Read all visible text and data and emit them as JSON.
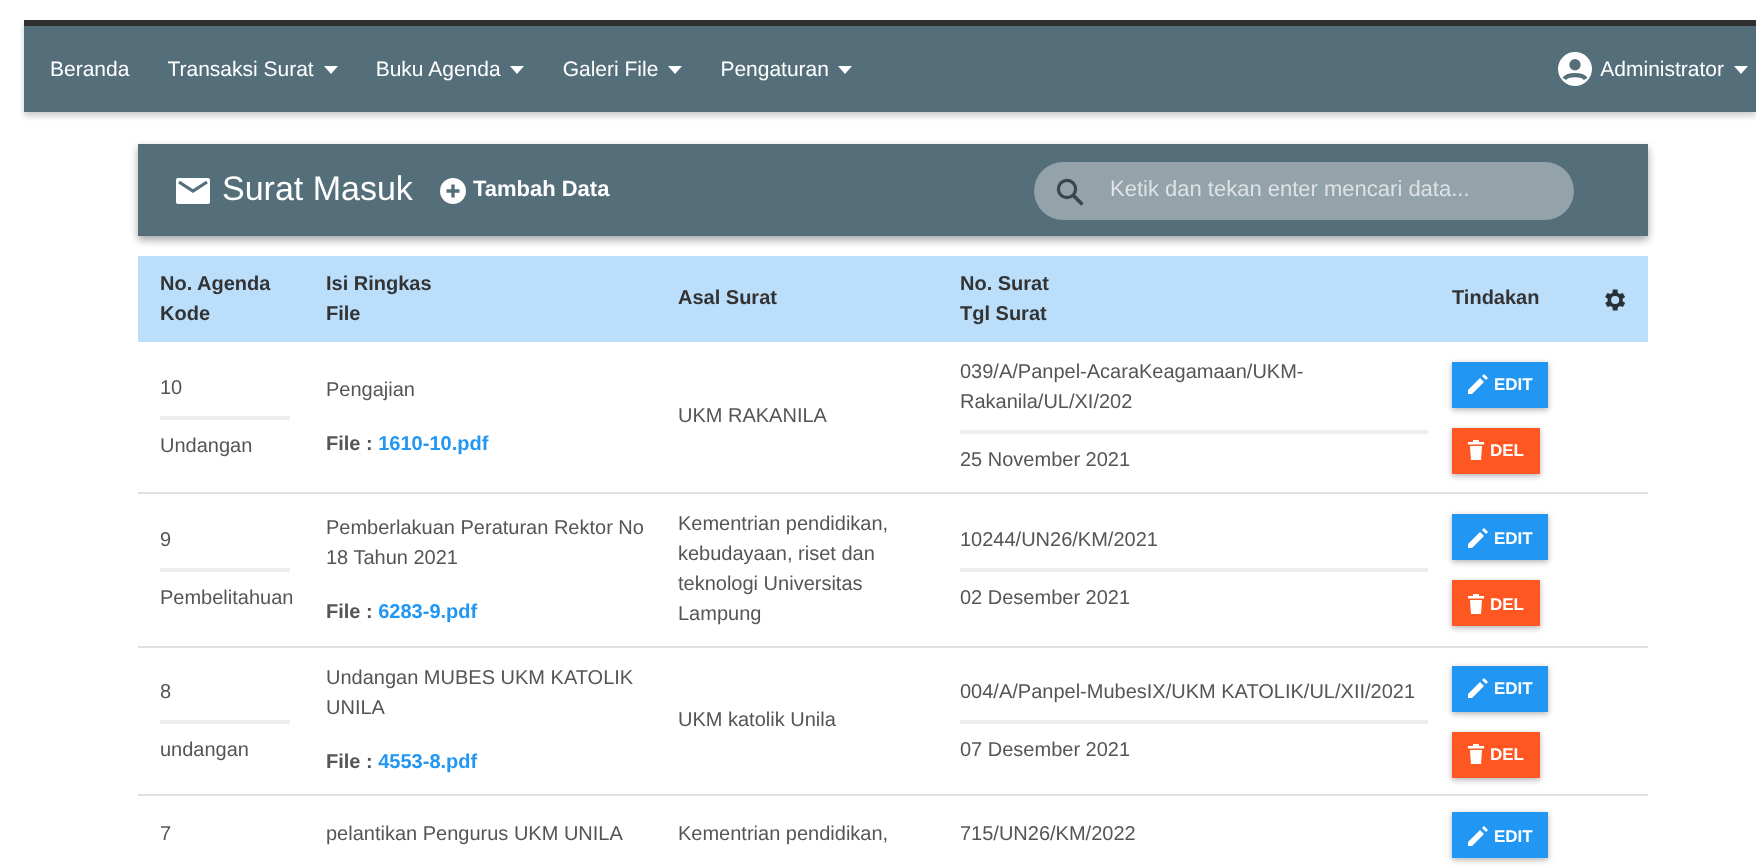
{
  "navbar": {
    "items": [
      {
        "label": "Beranda",
        "dropdown": false
      },
      {
        "label": "Transaksi Surat",
        "dropdown": true
      },
      {
        "label": "Buku Agenda",
        "dropdown": true
      },
      {
        "label": "Galeri File",
        "dropdown": true
      },
      {
        "label": "Pengaturan",
        "dropdown": true
      }
    ],
    "user": {
      "label": "Administrator",
      "dropdown": true
    }
  },
  "header": {
    "title": "Surat Masuk",
    "add_button": "Tambah Data",
    "search": {
      "placeholder": "Ketik dan tekan enter mencari data..."
    }
  },
  "table": {
    "columns": [
      {
        "kind": "text",
        "lines": [
          "No. Agenda",
          "Kode"
        ]
      },
      {
        "kind": "text",
        "lines": [
          "Isi Ringkas",
          "File"
        ]
      },
      {
        "kind": "text",
        "lines": [
          "Asal Surat"
        ]
      },
      {
        "kind": "text",
        "lines": [
          "No. Surat",
          "Tgl Surat"
        ]
      },
      {
        "kind": "text",
        "lines": [
          "Tindakan"
        ]
      },
      {
        "kind": "settings"
      }
    ],
    "rows": [
      {
        "agenda": "10",
        "kode": "Undangan",
        "isi": "Pengajian",
        "file_label": "File :",
        "file": "1610-10.pdf",
        "asal": "UKM RAKANILA",
        "no_surat": "039/A/Panpel-AcaraKeagamaan/UKM-Rakanila/UL/XI/202",
        "tgl": "25 November 2021",
        "actions": [
          {
            "kind": "edit",
            "label": "EDIT"
          },
          {
            "kind": "delete",
            "label": "DEL"
          }
        ]
      },
      {
        "agenda": "9",
        "kode": "Pembelitahuan",
        "isi": "Pemberlakuan Peraturan Rektor No 18 Tahun 2021",
        "file_label": "File :",
        "file": "6283-9.pdf",
        "asal": "Kementrian pendidikan, kebudayaan, riset dan teknologi Universitas Lampung",
        "no_surat": "10244/UN26/KM/2021",
        "tgl": "02 Desember 2021",
        "actions": [
          {
            "kind": "edit",
            "label": "EDIT"
          },
          {
            "kind": "delete",
            "label": "DEL"
          }
        ]
      },
      {
        "agenda": "8",
        "kode": "undangan",
        "isi": "Undangan MUBES UKM KATOLIK UNILA",
        "file_label": "File :",
        "file": "4553-8.pdf",
        "asal": "UKM katolik Unila",
        "no_surat": "004/A/Panpel-MubesIX/UKM KATOLIK/UL/XII/2021",
        "tgl": "07 Desember 2021",
        "actions": [
          {
            "kind": "edit",
            "label": "EDIT"
          },
          {
            "kind": "delete",
            "label": "DEL"
          }
        ]
      },
      {
        "agenda": "7",
        "isi": "pelantikan Pengurus UKM UNILA",
        "asal": "Kementrian pendidikan,",
        "no_surat": "715/UN26/KM/2022",
        "actions": [
          {
            "kind": "edit",
            "label": "EDIT"
          }
        ]
      }
    ]
  }
}
